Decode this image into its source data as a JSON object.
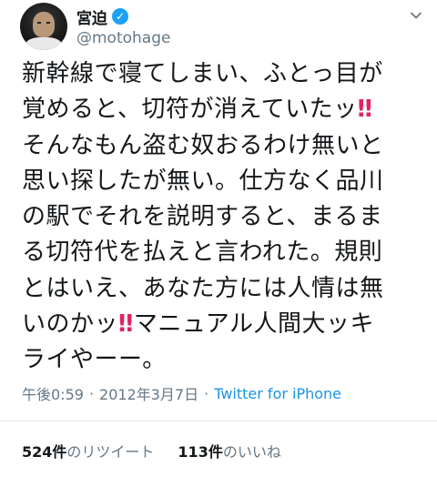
{
  "user": {
    "display_name": "宮迫",
    "handle": "@motohage"
  },
  "tweet": {
    "lines": [
      "新幹線で寝てしまい、ふとっ目が",
      "覚めると、切符が消えていたッ",
      "そんなもん盗む奴おるわけ無いと",
      "思い探したが無い。仕方なく品川",
      "の駅でそれを説明すると、まるま",
      "る切符代を払えと言われた。規則",
      "とはいえ、あなた方には人情は無",
      "いのかッ",
      "ライやーー。"
    ],
    "line8_tail": "マニュアル人間大ッキ",
    "exclamation": "‼"
  },
  "meta": {
    "time": "午後0:59",
    "separator": "·",
    "date": "2012年3月7日",
    "separator2": "·",
    "source": "Twitter for iPhone"
  },
  "stats": {
    "retweets_count": "524件",
    "retweets_label": "のリツイート",
    "likes_count": "113件",
    "likes_label": "のいいね"
  },
  "colors": {
    "verified": "#1da1f2",
    "link": "#1b95e0",
    "secondary": "#657786",
    "exclamation": "#e0245e"
  },
  "icons": {
    "verified": "verified-badge-icon",
    "menu": "chevron-down-icon"
  }
}
